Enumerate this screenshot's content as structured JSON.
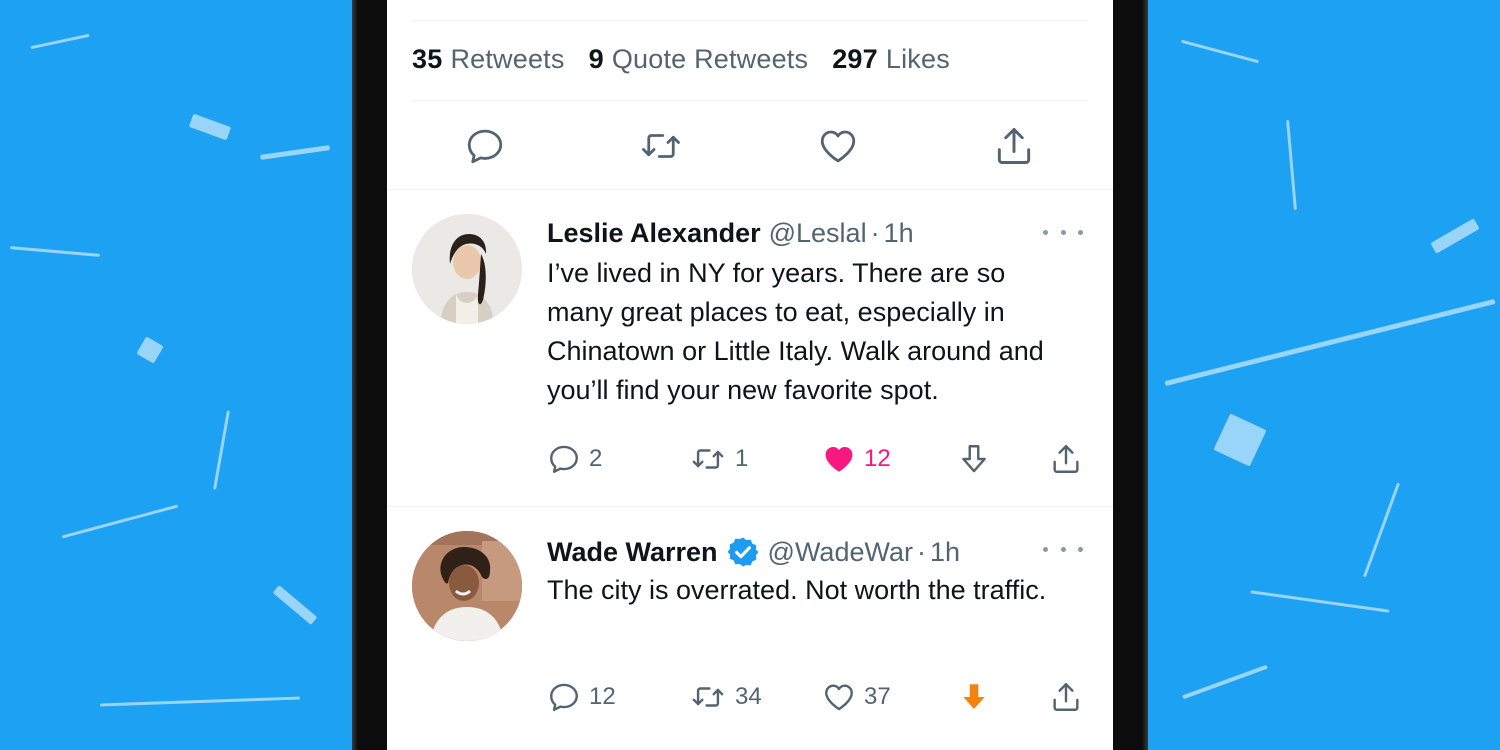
{
  "colors": {
    "background": "#1da1f2",
    "like_active": "#f91880",
    "downvote_active": "#f5820b",
    "icon_gray": "#536471",
    "verified_blue": "#1d9bf0"
  },
  "stats": [
    {
      "count": "35",
      "label": "Retweets"
    },
    {
      "count": "9",
      "label": "Quote Retweets"
    },
    {
      "count": "297",
      "label": "Likes"
    }
  ],
  "main_actions": [
    "reply-icon",
    "retweet-icon",
    "like-icon",
    "share-icon"
  ],
  "tweets": [
    {
      "name": "Leslie Alexander",
      "handle": "@Leslal",
      "time": "1h",
      "verified": false,
      "text": "I’ve lived in NY for years. There are so many great places to eat, especially in Chinatown or Little Italy. Walk around and you’ll find your new favorite spot.",
      "replies": "2",
      "retweets": "1",
      "likes": "12",
      "liked": true,
      "downvoted": false
    },
    {
      "name": "Wade Warren",
      "handle": "@WadeWar",
      "time": "1h",
      "verified": true,
      "text": "The city is overrated. Not worth the traffic.",
      "replies": "12",
      "retweets": "34",
      "likes": "37",
      "liked": false,
      "downvoted": true
    }
  ],
  "separator": "·"
}
